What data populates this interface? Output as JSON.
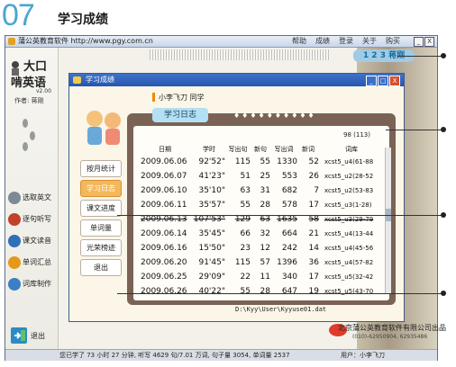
{
  "heading": {
    "number": "07",
    "title": "学习成绩"
  },
  "app": {
    "title": "蒲公英教育软件 http://www.pgy.com.cn",
    "menu": [
      "帮助",
      "成绩",
      "登录",
      "关于",
      "购买"
    ],
    "window_buttons": [
      "_",
      "X"
    ]
  },
  "logo": {
    "line1": "大口",
    "line2": "啃英语",
    "version": "v2.00",
    "author": "作者: 蒋刚"
  },
  "sidebar": {
    "items": [
      {
        "label": "选取英文",
        "icon": "book-icon",
        "color": "#7d8a96"
      },
      {
        "label": "逐句听写",
        "icon": "headphones-icon",
        "color": "#c2412a"
      },
      {
        "label": "课文读音",
        "icon": "reading-icon",
        "color": "#2f6fb8"
      },
      {
        "label": "单词汇总",
        "icon": "word-icon",
        "color": "#e39a1a"
      },
      {
        "label": "词库制作",
        "icon": "library-icon",
        "color": "#3d7fc4"
      }
    ],
    "exit_label": "退出"
  },
  "badge": {
    "text": "1 2 3 蒋刚"
  },
  "study_window": {
    "title": "学习成绩",
    "buttons": [
      "_",
      "□",
      "X"
    ],
    "greeting": "小李飞刀 同学",
    "diary_tab": "学习日志",
    "count": "98 (113)",
    "menu": [
      "按月统计",
      "学习日志",
      "课文进度",
      "单词量",
      "光荣榜迹",
      "退出"
    ],
    "active_menu": 1,
    "columns": [
      "日期",
      "学时",
      "写出句",
      "新句",
      "写出词",
      "新词",
      "词库"
    ],
    "rows": [
      [
        "2009.06.06",
        "92'52\"",
        "115",
        "55",
        "1330",
        "52",
        "xcst5_u4(61-88"
      ],
      [
        "2009.06.07",
        "41'23\"",
        "51",
        "25",
        "553",
        "26",
        "xcst5_u2(28-52"
      ],
      [
        "2009.06.10",
        "35'10\"",
        "63",
        "31",
        "682",
        "7",
        "xcst5_u2(53-83"
      ],
      [
        "2009.06.11",
        "35'57\"",
        "55",
        "28",
        "578",
        "17",
        "xcst5_u3(1-28)"
      ],
      [
        "2009.06.13",
        "107'53\"",
        "129",
        "63",
        "1635",
        "58",
        "xcst5_u3(29-79"
      ],
      [
        "2009.06.14",
        "35'45\"",
        "66",
        "32",
        "664",
        "21",
        "xcst5_u4(13-44"
      ],
      [
        "2009.06.16",
        "15'50\"",
        "23",
        "12",
        "242",
        "14",
        "xcst5_u4(45-56"
      ],
      [
        "2009.06.20",
        "91'45\"",
        "115",
        "57",
        "1396",
        "36",
        "xcst5_u4(57-82"
      ],
      [
        "2009.06.25",
        "29'09\"",
        "22",
        "11",
        "340",
        "17",
        "xcst5_u5(32-42"
      ],
      [
        "2009.06.26",
        "40'22\"",
        "55",
        "28",
        "647",
        "19",
        "xcst5_u5(43-70"
      ]
    ],
    "path": "D:\\Kyy\\User\\Kyyuse01.dat",
    "company": "北京蒲公英教育软件有限公司出品",
    "phone": "(010)-62950904, 62935486"
  },
  "status": {
    "text": "您已学了 73 小时 27 分钟, 听写 4629 句/7.01 万词, 句子量 3054, 单词量 2537",
    "user": "用户：小李飞刀"
  }
}
